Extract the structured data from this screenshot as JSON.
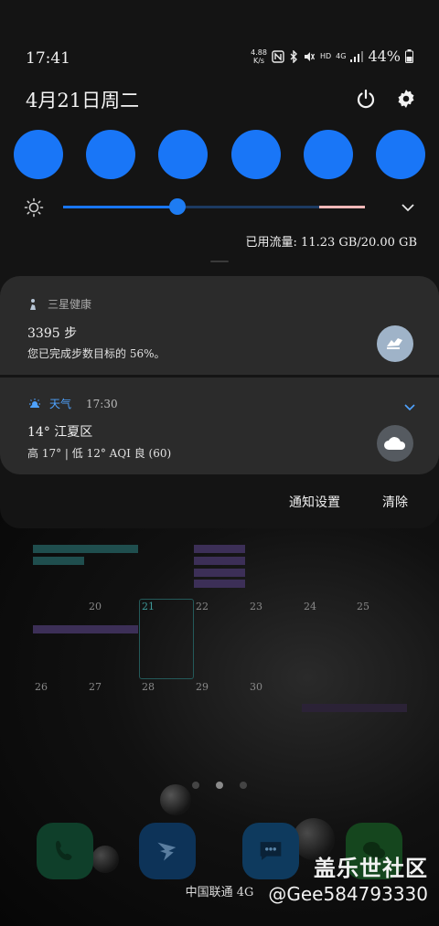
{
  "status_bar": {
    "time": "17:41",
    "net_speed_value": "4.88",
    "net_speed_unit": "K/s",
    "network_type": "4G",
    "hd_label": "HD",
    "battery": "44%"
  },
  "header": {
    "date": "4月21日周二",
    "power_icon": "power-icon",
    "settings_icon": "gear-icon"
  },
  "quick_tiles": [
    {
      "state": "on",
      "color": "#1976f7"
    },
    {
      "state": "on",
      "color": "#1976f7"
    },
    {
      "state": "on",
      "color": "#1976f7"
    },
    {
      "state": "on",
      "color": "#1976f7"
    },
    {
      "state": "on",
      "color": "#1976f7"
    },
    {
      "state": "on",
      "color": "#1976f7"
    }
  ],
  "brightness": {
    "level": 0.38,
    "icon": "brightness-icon",
    "expand_icon": "chevron-down-icon"
  },
  "data_usage": "已用流量: 11.23 GB/20.00 GB",
  "notifications": [
    {
      "app": "三星健康",
      "time": "",
      "title": "3395 步",
      "body": "您已完成步数目标的 56%。",
      "icon": "health-icon",
      "thumb_icon": "shoe-icon"
    },
    {
      "app": "天气",
      "time": "17:30",
      "title": "14° 江夏区",
      "body": "高 17° | 低 12° AQI 良 (60)",
      "icon": "weather-icon",
      "thumb_icon": "cloud-icon"
    }
  ],
  "actions": {
    "settings": "通知设置",
    "clear": "清除"
  },
  "background": {
    "calendar_dates": [
      "20",
      "21",
      "22",
      "23",
      "24",
      "25",
      "26",
      "27",
      "28",
      "29",
      "30"
    ],
    "carrier": "中国联通 4G",
    "dock_icons": [
      "phone-icon",
      "dingtalk-icon",
      "messages-icon",
      "wechat-icon"
    ]
  },
  "watermark": {
    "site": "盖乐世社区",
    "user": "@Gee584793330"
  },
  "colors": {
    "accent": "#1976f7",
    "shade": "#141414",
    "card": "#2b2b2b"
  }
}
